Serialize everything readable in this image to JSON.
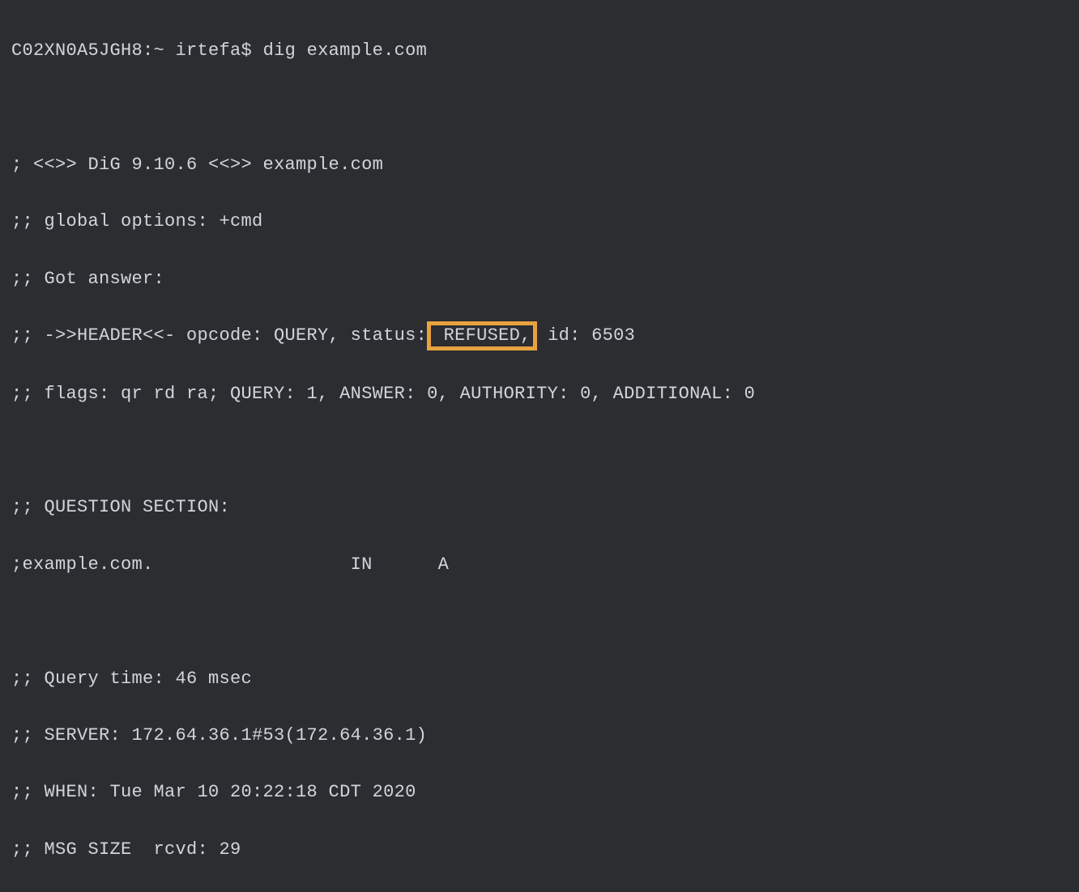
{
  "terminal": {
    "prompt_host": "C02XN0A5JGH8:~",
    "prompt_user": "irtefa$",
    "command": "dig example.com",
    "dig_version_line": "; <<>> DiG 9.10.6 <<>> example.com",
    "global_options_line": ";; global options: +cmd",
    "got_answer_line": ";; Got answer:",
    "header_prefix": ";; ->>HEADER<<- opcode: QUERY, status:",
    "header_status_highlighted": " REFUSED,",
    "header_suffix": " id: 6503",
    "flags_line": ";; flags: qr rd ra; QUERY: 1, ANSWER: 0, AUTHORITY: 0, ADDITIONAL: 0",
    "question_section_header": ";; QUESTION SECTION:",
    "question_line": ";example.com.                  IN      A",
    "query_time_line": ";; Query time: 46 msec",
    "server_line": ";; SERVER: 172.64.36.1#53(172.64.36.1)",
    "when_line": ";; WHEN: Tue Mar 10 20:22:18 CDT 2020",
    "msg_size_line": ";; MSG SIZE  rcvd: 29"
  },
  "highlight_color": "#e8a23f"
}
